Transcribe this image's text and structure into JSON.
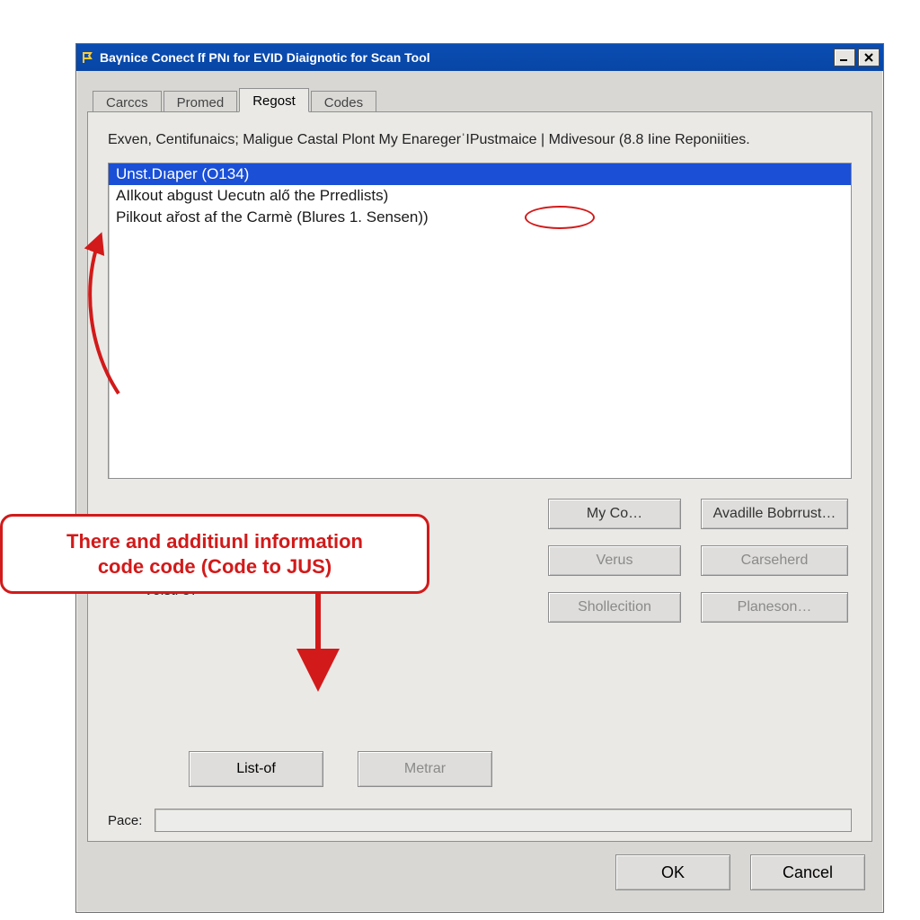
{
  "window": {
    "title": "Baγnice Conect  ſf PNı for EVID Diaignotic for Scan Tool"
  },
  "tabs": [
    {
      "label": "Carccs",
      "active": false
    },
    {
      "label": "Promed",
      "active": false
    },
    {
      "label": "Regost",
      "active": true
    },
    {
      "label": "Codes",
      "active": false
    }
  ],
  "panel": {
    "description": "Exven, Centifunaics; Maligue Castal Plont My EnaregerˈIPustmaice | Mdivesour (8.8 Iine Reponiities.",
    "list_items": [
      "Unst.Dıaper  (O134)",
      "AIlkout abgust Uecutn alő the Prredlists)",
      "Pilkout ařost af the Carmè (Blures 1. Sensen))"
    ],
    "voisti_label": "Voisti 87",
    "buttons_right": [
      "My Co…",
      "Avadille Bobrrust…",
      "Verus",
      "Carseherd",
      "Shollecition",
      "Planeson…"
    ],
    "lower_buttons": [
      "List‑of",
      "Metrar"
    ],
    "pace_label": "Pace:"
  },
  "dialog_buttons": {
    "ok": "OK",
    "cancel": "Cancel"
  },
  "callout": {
    "line1": "There and additiunl information",
    "line2": "code code (Code to JUS)"
  }
}
